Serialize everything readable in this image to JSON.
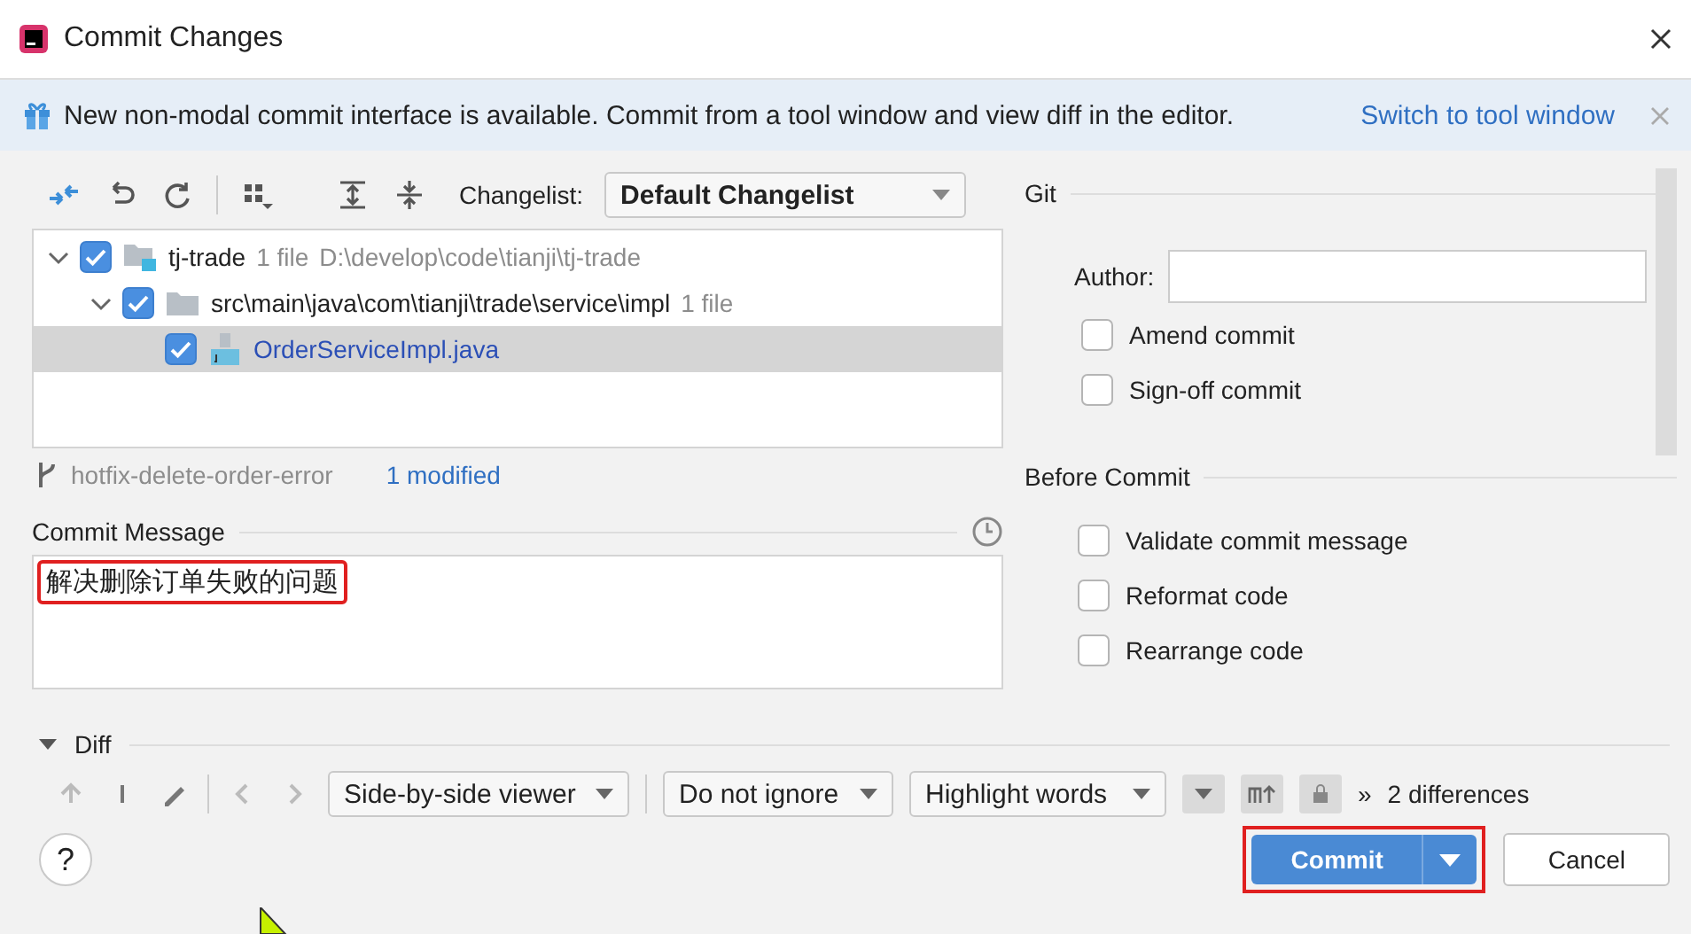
{
  "window": {
    "title": "Commit Changes"
  },
  "banner": {
    "text": "New non-modal commit interface is available. Commit from a tool window and view diff in the editor.",
    "link": "Switch to tool window"
  },
  "changelist": {
    "label": "Changelist:",
    "value": "Default Changelist"
  },
  "tree": [
    {
      "kind": "module",
      "label": "tj-trade",
      "count": "1 file",
      "path": "D:\\develop\\code\\tianji\\tj-trade",
      "checked": true,
      "expanded": true,
      "selected": false,
      "children": [
        {
          "kind": "folder",
          "label": "src\\main\\java\\com\\tianji\\trade\\service\\impl",
          "count": "1 file",
          "checked": true,
          "expanded": true,
          "selected": false,
          "children": [
            {
              "kind": "file",
              "label": "OrderServiceImpl.java",
              "checked": true,
              "selected": true
            }
          ]
        }
      ]
    }
  ],
  "branch": "hotfix-delete-order-error",
  "modified": "1 modified",
  "commit_message": {
    "label": "Commit Message",
    "value": "解决删除订单失败的问题"
  },
  "git": {
    "title": "Git",
    "author_label": "Author:",
    "options": [
      {
        "label": "Amend commit",
        "checked": false
      },
      {
        "label": "Sign-off commit",
        "checked": false
      }
    ]
  },
  "before_commit": {
    "title": "Before Commit",
    "options": [
      {
        "label": "Validate commit message",
        "checked": false
      },
      {
        "label": "Reformat code",
        "checked": false
      },
      {
        "label": "Rearrange code",
        "checked": false
      }
    ]
  },
  "diff": {
    "title": "Diff",
    "expanded": true,
    "viewer": "Side-by-side viewer",
    "ignore": "Do not ignore",
    "highlight": "Highlight words",
    "more": "»",
    "summary": "2 differences"
  },
  "buttons": {
    "help": "?",
    "commit": "Commit",
    "cancel": "Cancel"
  }
}
